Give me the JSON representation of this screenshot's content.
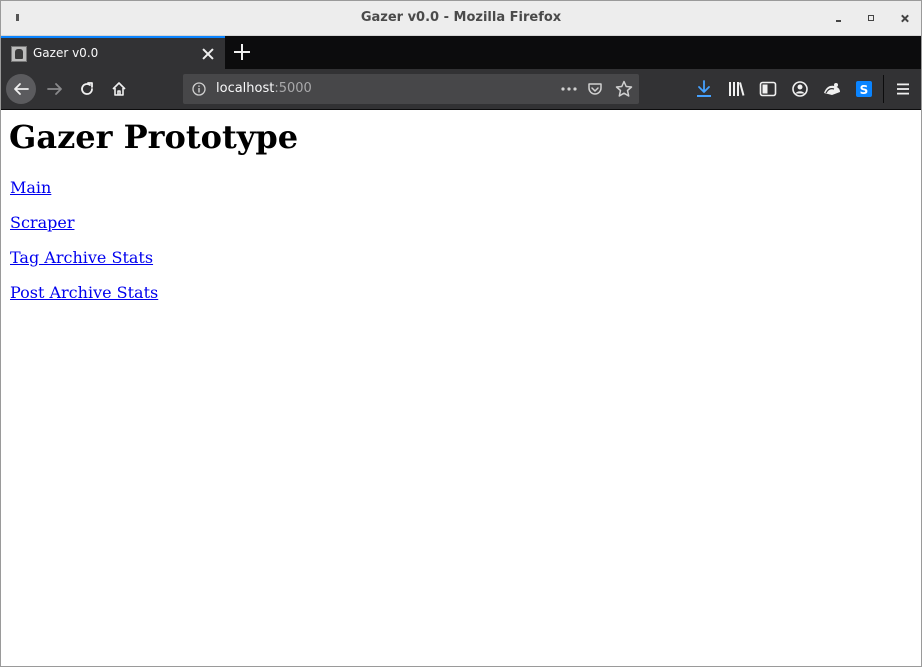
{
  "window": {
    "title": "Gazer v0.0 - Mozilla Firefox"
  },
  "tabs": [
    {
      "title": "Gazer v0.0",
      "active": true,
      "favicon": "gazer-favicon"
    }
  ],
  "toolbar": {
    "url_host": "localhost",
    "url_port": ":5000",
    "icons": [
      "back-icon",
      "forward-icon",
      "reload-icon",
      "home-icon",
      "info-icon",
      "page-actions-icon",
      "pocket-icon",
      "bookmark-star-icon",
      "download-icon",
      "library-icon",
      "sidebar-icon",
      "account-icon",
      "extension-icon",
      "skype-icon",
      "hamburger-menu-icon"
    ],
    "accent": "#0a84ff"
  },
  "page": {
    "heading": "Gazer Prototype",
    "links": [
      {
        "label": "Main"
      },
      {
        "label": "Scraper"
      },
      {
        "label": "Tag Archive Stats"
      },
      {
        "label": "Post Archive Stats"
      }
    ],
    "link_color": "#0000ee"
  }
}
